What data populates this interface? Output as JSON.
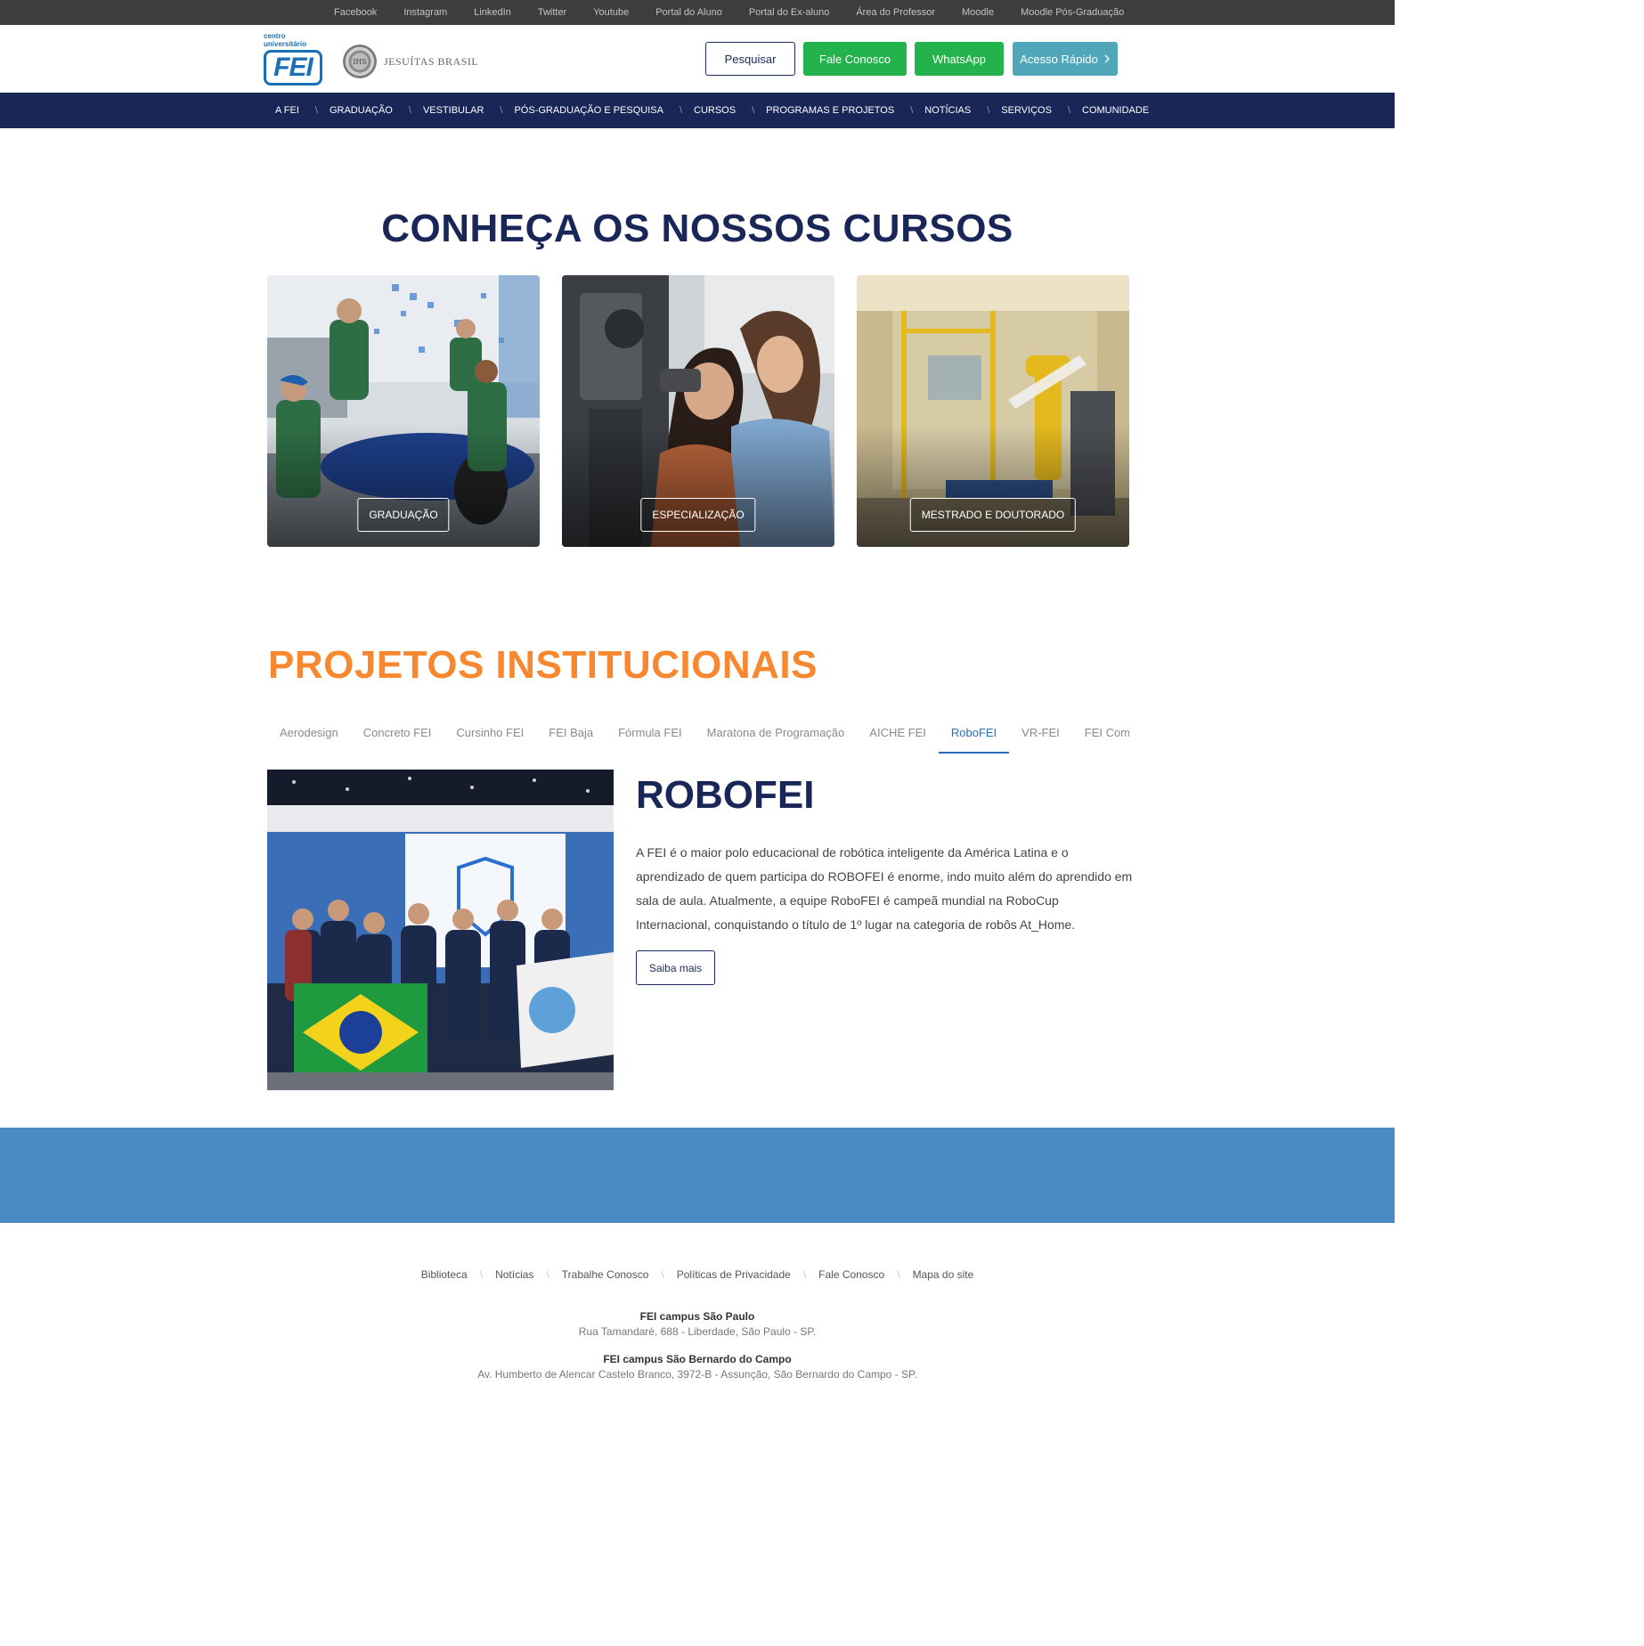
{
  "topbar": {
    "links": [
      "Facebook",
      "Instagram",
      "LinkedIn",
      "Twitter",
      "Youtube",
      "Portal do Aluno",
      "Portal do Ex-aluno",
      "Área do Professor",
      "Moodle",
      "Moodle Pós-Graduação"
    ]
  },
  "header": {
    "logo_small_line1": "centro",
    "logo_small_line2": "universitário",
    "logo_big": "FEI",
    "jesuitas_label": "JESUÍTAS BRASIL",
    "seal_text": "IHS",
    "buttons": {
      "search": "Pesquisar",
      "contact": "Fale Conosco",
      "whatsapp": "WhatsApp",
      "quick_access": "Acesso Rápido"
    },
    "quick_access_icon": "chevron-right-icon"
  },
  "mainnav": {
    "items": [
      "A FEI",
      "GRADUAÇÃO",
      "VESTIBULAR",
      "PÓS-GRADUAÇÃO E PESQUISA",
      "CURSOS",
      "PROGRAMAS E PROJETOS",
      "NOTÍCIAS",
      "SERVIÇOS",
      "COMUNIDADE"
    ]
  },
  "courses": {
    "title": "CONHEÇA OS NOSSOS CURSOS",
    "cards": [
      {
        "label": "GRADUAÇÃO"
      },
      {
        "label": "ESPECIALIZAÇÃO"
      },
      {
        "label": "MESTRADO E DOUTORADO"
      }
    ]
  },
  "projects": {
    "title": "PROJETOS INSTITUCIONAIS",
    "tabs": [
      "Aerodesign",
      "Concreto FEI",
      "Cursinho FEI",
      "FEI Baja",
      "Fórmula FEI",
      "Maratona de Programação",
      "AICHE FEI",
      "RoboFEI",
      "VR-FEI",
      "FEI Compósitos"
    ],
    "active_tab": "RoboFEI",
    "active": {
      "name": "ROBOFEI",
      "description": "A FEI é o maior polo educacional de robótica inteligente da América Latina e o aprendizado de quem participa do ROBOFEI é enorme, indo muito além do aprendido em sala de aula. Atualmente, a equipe RoboFEI é campeã mundial na RoboCup Internacional, conquistando o título de 1º lugar na categoria de robôs At_Home.",
      "more": "Saiba mais"
    }
  },
  "footer": {
    "links": [
      "Biblioteca",
      "Notícias",
      "Trabalhe Conosco",
      "Políticas de Privacidade",
      "Fale Conosco",
      "Mapa do site"
    ],
    "campuses": [
      {
        "name": "FEI campus São Paulo",
        "address": "Rua Tamandaré, 688 - Liberdade, São Paulo - SP."
      },
      {
        "name": "FEI campus São Bernardo do Campo",
        "address": "Av. Humberto de Alencar Castelo Branco, 3972-B - Assunção, São Bernardo do Campo - SP."
      }
    ]
  },
  "colors": {
    "navy": "#182658",
    "orange": "#f7882f",
    "green": "#23b24b",
    "teal": "#4fa7b9",
    "band_blue": "#4a8ac5",
    "topbar": "#3d3d3d"
  }
}
